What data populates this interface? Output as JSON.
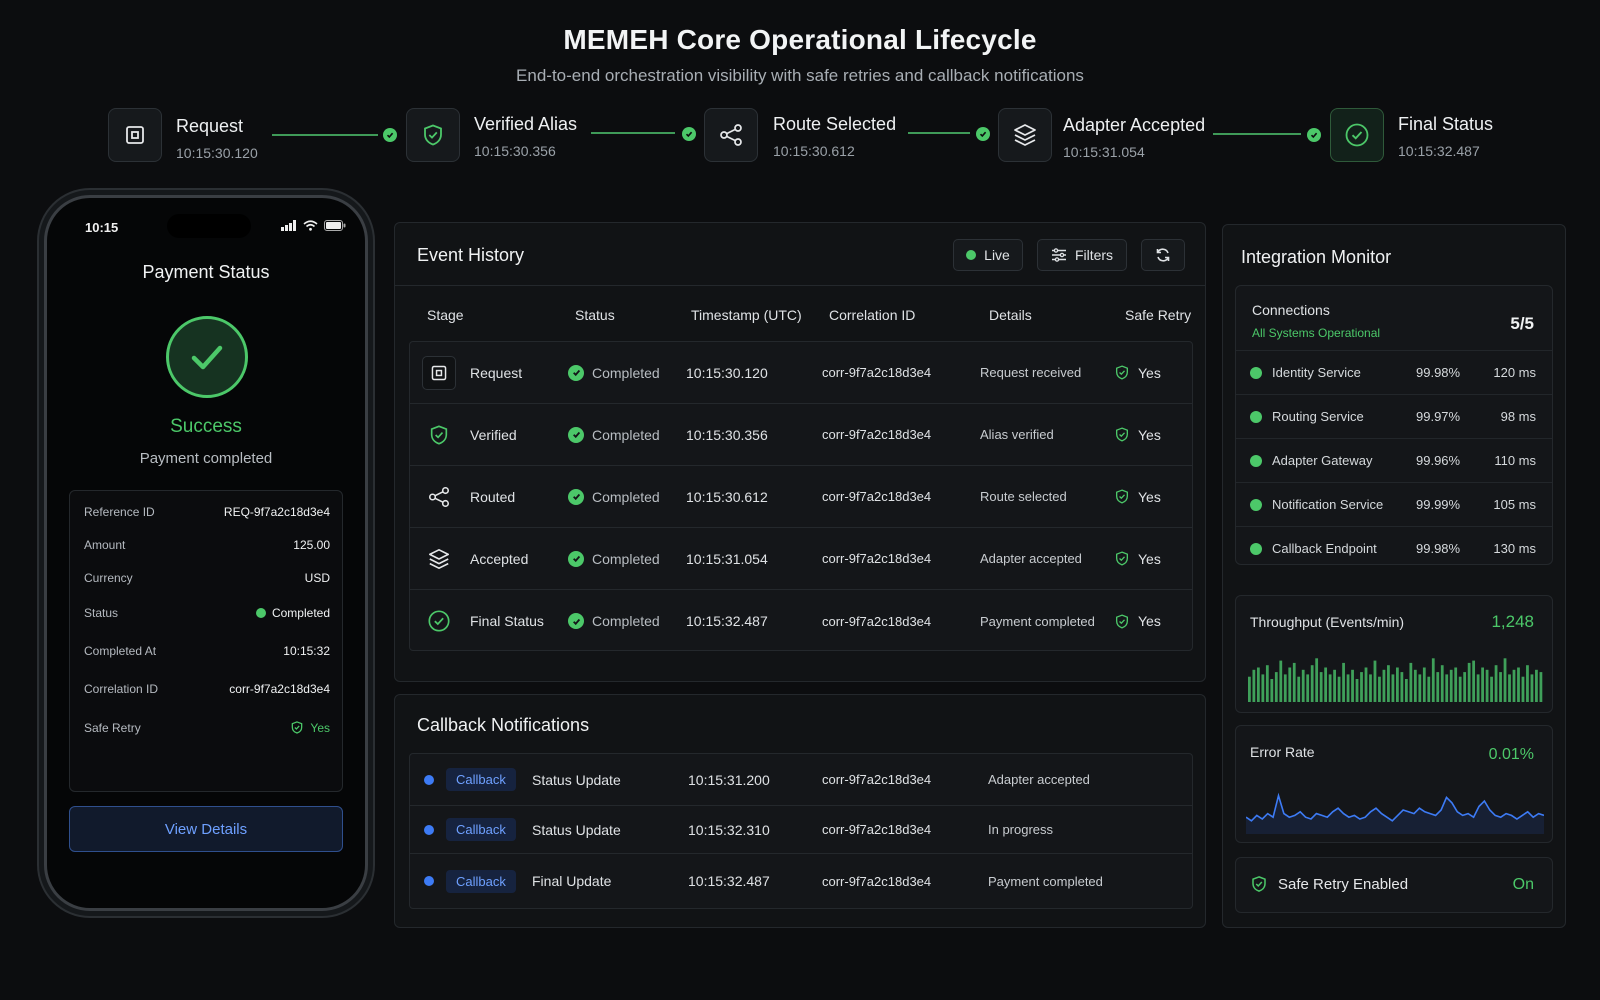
{
  "header": {
    "title": "MEMEH Core Operational Lifecycle",
    "subtitle": "End-to-end orchestration visibility with safe retries and callback notifications"
  },
  "pipeline": [
    {
      "name": "Request",
      "time": "10:15:30.120",
      "icon": "request-box-icon"
    },
    {
      "name": "Verified Alias",
      "time": "10:15:30.356",
      "icon": "shield-check-icon"
    },
    {
      "name": "Route Selected",
      "time": "10:15:30.612",
      "icon": "share-route-icon"
    },
    {
      "name": "Adapter Accepted",
      "time": "10:15:31.054",
      "icon": "layers-icon"
    },
    {
      "name": "Final Status",
      "time": "10:15:32.487",
      "icon": "check-circle-icon"
    }
  ],
  "phone": {
    "time": "10:15",
    "title": "Payment Status",
    "success": "Success",
    "subtitle": "Payment completed",
    "details": [
      {
        "key": "Reference ID",
        "value": "REQ-9f7a2c18d3e4"
      },
      {
        "key": "Amount",
        "value": "125.00"
      },
      {
        "key": "Currency",
        "value": "USD"
      },
      {
        "key": "Status",
        "value": "Completed"
      },
      {
        "key": "Completed At",
        "value": "10:15:32"
      },
      {
        "key": "Correlation ID",
        "value": "corr-9f7a2c18d3e4"
      },
      {
        "key": "Safe Retry",
        "value": "Yes"
      }
    ],
    "button": "View Details"
  },
  "events": {
    "title": "Event History",
    "live": "Live",
    "filters": "Filters",
    "columns": [
      "Stage",
      "Status",
      "Timestamp (UTC)",
      "Correlation ID",
      "Details",
      "Safe Retry"
    ],
    "rows": [
      {
        "stage": "Request",
        "status": "Completed",
        "timestamp": "10:15:30.120",
        "corr": "corr-9f7a2c18d3e4",
        "details": "Request received",
        "retry": "Yes"
      },
      {
        "stage": "Verified",
        "status": "Completed",
        "timestamp": "10:15:30.356",
        "corr": "corr-9f7a2c18d3e4",
        "details": "Alias verified",
        "retry": "Yes"
      },
      {
        "stage": "Routed",
        "status": "Completed",
        "timestamp": "10:15:30.612",
        "corr": "corr-9f7a2c18d3e4",
        "details": "Route selected",
        "retry": "Yes"
      },
      {
        "stage": "Accepted",
        "status": "Completed",
        "timestamp": "10:15:31.054",
        "corr": "corr-9f7a2c18d3e4",
        "details": "Adapter accepted",
        "retry": "Yes"
      },
      {
        "stage": "Final Status",
        "status": "Completed",
        "timestamp": "10:15:32.487",
        "corr": "corr-9f7a2c18d3e4",
        "details": "Payment completed",
        "retry": "Yes"
      }
    ]
  },
  "callbacks": {
    "title": "Callback Notifications",
    "rows": [
      {
        "badge": "Callback",
        "type": "Status Update",
        "timestamp": "10:15:31.200",
        "corr": "corr-9f7a2c18d3e4",
        "details": "Adapter accepted"
      },
      {
        "badge": "Callback",
        "type": "Status Update",
        "timestamp": "10:15:32.310",
        "corr": "corr-9f7a2c18d3e4",
        "details": "In progress"
      },
      {
        "badge": "Callback",
        "type": "Final Update",
        "timestamp": "10:15:32.487",
        "corr": "corr-9f7a2c18d3e4",
        "details": "Payment completed"
      }
    ]
  },
  "monitor": {
    "title": "Integration Monitor",
    "connections_label": "Connections",
    "connections_status": "All Systems Operational",
    "connections_count": "5/5",
    "services": [
      {
        "name": "Identity Service",
        "uptime": "99.98%",
        "latency": "120 ms"
      },
      {
        "name": "Routing Service",
        "uptime": "99.97%",
        "latency": "98 ms"
      },
      {
        "name": "Adapter Gateway",
        "uptime": "99.96%",
        "latency": "110 ms"
      },
      {
        "name": "Notification Service",
        "uptime": "99.99%",
        "latency": "105 ms"
      },
      {
        "name": "Callback Endpoint",
        "uptime": "99.98%",
        "latency": "130 ms"
      }
    ],
    "throughput_label": "Throughput (Events/min)",
    "throughput_value": "1,248",
    "throughput_bars": [
      0.55,
      0.7,
      0.75,
      0.6,
      0.8,
      0.5,
      0.65,
      0.9,
      0.6,
      0.75,
      0.85,
      0.55,
      0.7,
      0.6,
      0.8,
      0.95,
      0.65,
      0.75,
      0.6,
      0.7,
      0.55,
      0.85,
      0.6,
      0.7,
      0.5,
      0.65,
      0.75,
      0.6,
      0.9,
      0.55,
      0.7,
      0.8,
      0.6,
      0.75,
      0.65,
      0.5,
      0.85,
      0.7,
      0.6,
      0.75,
      0.55,
      0.95,
      0.65,
      0.8,
      0.6,
      0.7,
      0.75,
      0.55,
      0.65,
      0.85,
      0.9,
      0.6,
      0.75,
      0.7,
      0.55,
      0.8,
      0.65,
      0.95,
      0.6,
      0.7,
      0.75,
      0.55,
      0.8,
      0.6,
      0.7,
      0.65
    ],
    "error_label": "Error Rate",
    "error_value": "0.01%",
    "error_series": [
      0.3,
      0.2,
      0.35,
      0.25,
      0.4,
      0.3,
      0.9,
      0.4,
      0.3,
      0.35,
      0.45,
      0.3,
      0.25,
      0.4,
      0.35,
      0.3,
      0.45,
      0.55,
      0.4,
      0.3,
      0.35,
      0.25,
      0.3,
      0.45,
      0.55,
      0.4,
      0.3,
      0.2,
      0.35,
      0.5,
      0.45,
      0.4,
      0.55,
      0.45,
      0.4,
      0.35,
      0.5,
      0.85,
      0.7,
      0.45,
      0.35,
      0.4,
      0.3,
      0.6,
      0.75,
      0.5,
      0.35,
      0.3,
      0.4,
      0.35,
      0.25,
      0.35,
      0.45,
      0.3,
      0.4,
      0.35
    ],
    "safe_retry_label": "Safe Retry Enabled",
    "safe_retry_value": "On"
  },
  "colors": {
    "accent_green": "#4cc869",
    "accent_blue": "#3d7bf5",
    "background": "#0c0d0f"
  }
}
